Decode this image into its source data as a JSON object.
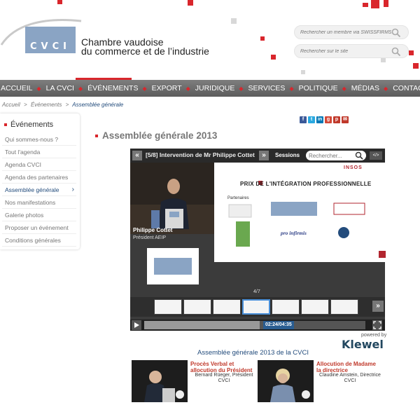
{
  "header": {
    "org_line1": "Chambre vaudoise",
    "org_line2": "du commerce et de l’industrie",
    "logo_text": "CVCI",
    "search_member_placeholder": "Rechercher un membre via SWISSFIRMS",
    "search_site_placeholder": "Rechercher sur le site"
  },
  "nav": {
    "items": [
      "ACCUEIL",
      "LA CVCI",
      "ÉVÉNEMENTS",
      "EXPORT",
      "JURIDIQUE",
      "SERVICES",
      "POLITIQUE",
      "MÉDIAS",
      "CONTACT"
    ]
  },
  "breadcrumb": {
    "home": "Accueil",
    "parent": "Événements",
    "current": "Assemblée générale",
    "sep": ">"
  },
  "sidebar": {
    "title": "Événements",
    "items": [
      "Qui sommes-nous ?",
      "Tout l'agenda",
      "Agenda CVCI",
      "Agenda des partenaires",
      "Assemblée générale",
      "Nos manifestations",
      "Galerie photos",
      "Proposer un événement",
      "Conditions générales"
    ],
    "active_index": 4
  },
  "page": {
    "title": "Assemblée générale 2013"
  },
  "player": {
    "title": "[5/8] Intervention de Mr Philippe Cottet",
    "sessions_label": "Sessions",
    "search_placeholder": "Rechercher...",
    "embed_label": "</>",
    "prev_glyph": "«",
    "next_glyph": "»",
    "speaker_name": "Philippe Cottet",
    "speaker_role": "Président AEIP",
    "slide_counter": "4/7",
    "timecode": "02:24/04:35",
    "progress_fraction": 0.5236,
    "slide": {
      "heading": "PRIX DE L'INTÉGRATION PROFESSIONNELLE",
      "partners_label": "Partenaires",
      "infirmis": "pro infirmis",
      "unilogo": "INSOS"
    }
  },
  "branding": {
    "powered_by": "powered by",
    "klewel": "Klewel"
  },
  "series": {
    "title": "Assemblée générale 2013 de la CVCI",
    "clips": [
      {
        "title": "Procès Verbal et allocution du Président",
        "by": "Bernard Rüeger, Président CVCI"
      },
      {
        "title": "Allocution de Madame la directrice",
        "by": "Claudine Amstein, Directrice CVCI"
      }
    ]
  },
  "colors": {
    "brand_red": "#d9262c",
    "brand_blue": "#234c7c",
    "logo_blue": "#8aa4c4",
    "nav_grey": "#6d6d6d"
  }
}
